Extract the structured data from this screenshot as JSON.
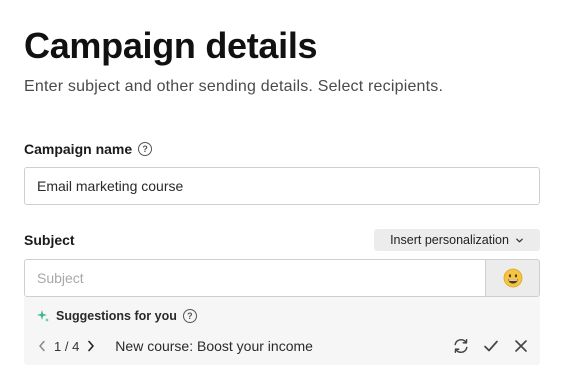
{
  "header": {
    "title": "Campaign details",
    "subtitle": "Enter subject and other sending details. Select recipients."
  },
  "campaign_name": {
    "label": "Campaign name",
    "value": "Email marketing course"
  },
  "subject": {
    "label": "Subject",
    "placeholder": "Subject",
    "value": "",
    "insert_personalization_label": "Insert personalization"
  },
  "suggestions": {
    "heading": "Suggestions for you",
    "page_current": "1",
    "page_total": "4",
    "page_text": "1 / 4",
    "text": "New course: Boost your income"
  },
  "icons": {
    "help": "help-circle-icon",
    "chevron": "chevron-down-icon",
    "emoji": "grinning-face-emoji-icon",
    "sparkle": "sparkle-icon",
    "prev": "chevron-left-icon",
    "next": "chevron-right-icon",
    "refresh": "refresh-icon",
    "accept": "check-icon",
    "dismiss": "close-icon"
  },
  "colors": {
    "sparkle": "#3ab795",
    "emoji_face": "#f5c542"
  }
}
